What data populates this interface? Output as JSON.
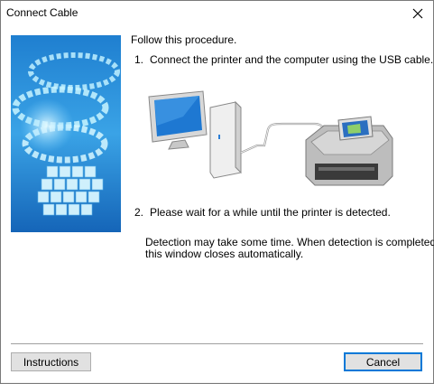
{
  "window": {
    "title": "Connect Cable"
  },
  "icons": {
    "close": "close-icon",
    "banner": "canon-spiral-banner",
    "computer": "computer-icon",
    "printer": "printer-icon",
    "cable": "usb-cable"
  },
  "main": {
    "intro": "Follow this procedure.",
    "step1_num": "1.",
    "step1_text": "Connect the printer and the computer using the USB cable.",
    "step2_num": "2.",
    "step2_text": "Please wait for a while until the printer is detected.",
    "note_line1": "Detection may take some time. When detection is completed,",
    "note_line2": "this window closes automatically."
  },
  "buttons": {
    "instructions": "Instructions",
    "cancel": "Cancel"
  },
  "colors": {
    "accent": "#0078d7",
    "banner_bg": "#2a8fd6"
  }
}
